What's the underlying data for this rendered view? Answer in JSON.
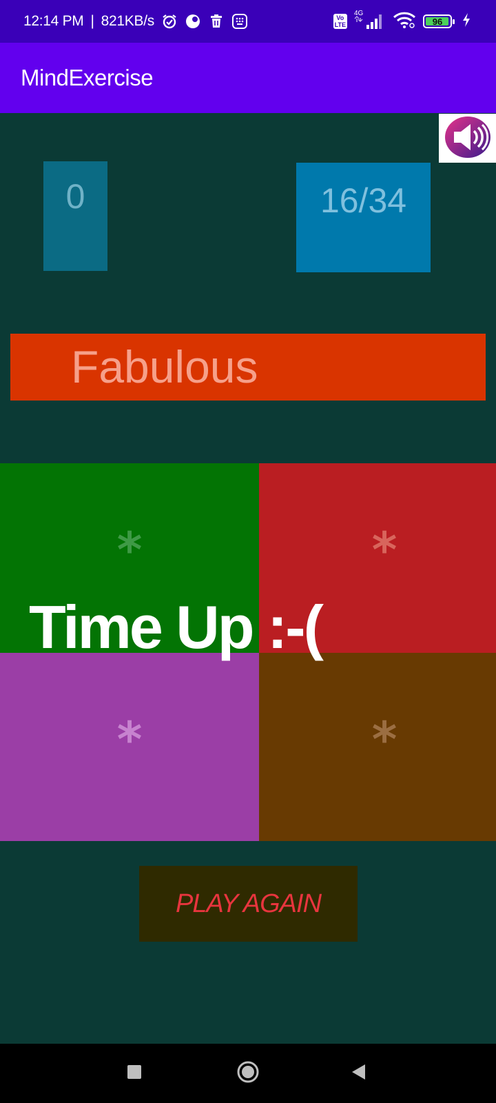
{
  "status_bar": {
    "time": "12:14 PM",
    "separator": "|",
    "speed": "821KB/s",
    "network_label": "4G",
    "volte_label": "Vo\nLTE",
    "battery_level": "96",
    "icons": [
      "alarm-icon",
      "app-notification-icon",
      "trash-icon",
      "keypad-icon",
      "volte-icon",
      "signal-icon",
      "wifi-icon",
      "battery-icon",
      "charging-icon"
    ]
  },
  "app_bar": {
    "title": "MindExercise"
  },
  "game": {
    "score": "0",
    "progress": "16/34",
    "message": "Fabulous",
    "tiles": [
      {
        "symbol": "*",
        "color": "#037404"
      },
      {
        "symbol": "*",
        "color": "#ba1e22"
      },
      {
        "symbol": "*",
        "color": "#9b3ea6"
      },
      {
        "symbol": "*",
        "color": "#683a02"
      }
    ],
    "overlay_text": "Time Up :-(",
    "play_again_label": "PLAY AGAIN"
  },
  "sound_button": {
    "icon": "speaker-icon"
  },
  "nav_bar": {
    "icons": [
      "recents-icon",
      "home-icon",
      "back-icon"
    ]
  },
  "colors": {
    "status_bar": "#3a00b8",
    "app_bar": "#6200ee",
    "background": "#0b3a35",
    "banner": "#d93400"
  }
}
